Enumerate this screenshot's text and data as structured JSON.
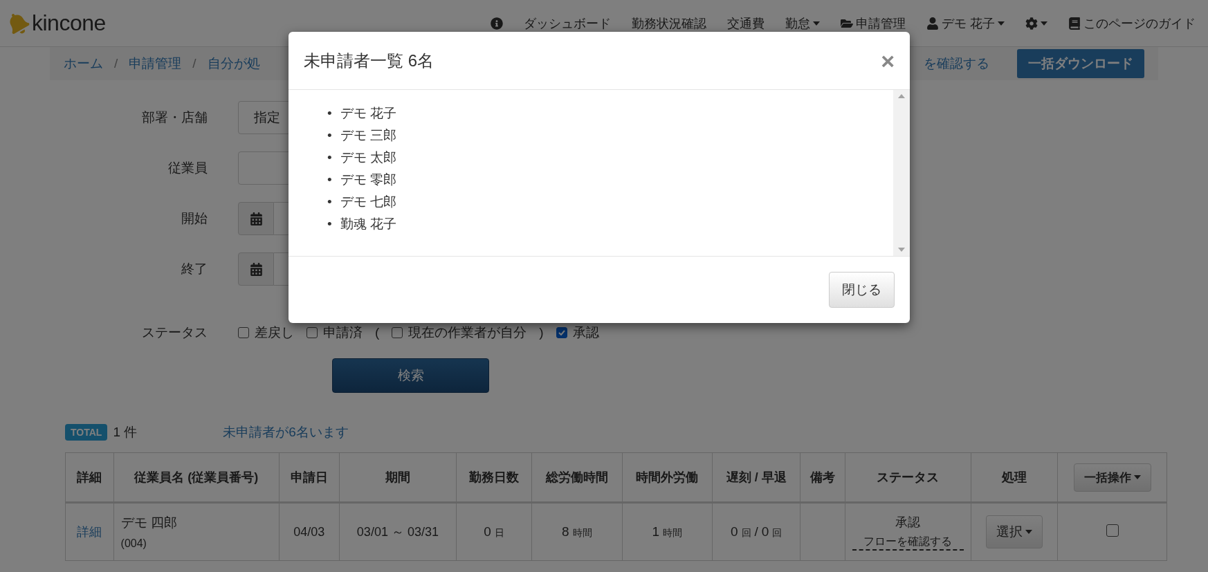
{
  "navbar": {
    "logo": "kincone",
    "items": [
      {
        "kind": "info"
      },
      {
        "kind": "text",
        "label": "ダッシュボード"
      },
      {
        "kind": "text",
        "label": "勤務状況確認"
      },
      {
        "kind": "text",
        "label": "交通費"
      },
      {
        "kind": "menu",
        "label": "勤怠"
      },
      {
        "kind": "folder",
        "label": "申請管理"
      },
      {
        "kind": "user",
        "label": "デモ 花子"
      },
      {
        "kind": "settings"
      },
      {
        "kind": "guide",
        "label": "このページのガイド"
      }
    ]
  },
  "breadcrumb": {
    "separator": "/",
    "items": [
      "ホーム",
      "申請管理",
      "自分が処"
    ],
    "link": "を確認する",
    "button": "一括ダウンロード"
  },
  "form": {
    "rows": [
      {
        "kind": "select",
        "label": "部署・店舗",
        "value": "指定"
      },
      {
        "kind": "input",
        "label": "従業員"
      },
      {
        "kind": "date",
        "label": "開始"
      },
      {
        "kind": "date",
        "label": "終了"
      }
    ],
    "status": {
      "label": "ステータス",
      "options": [
        {
          "kind": "plain",
          "label": "差戻し",
          "checked": false
        },
        {
          "kind": "plain",
          "label": "申請済",
          "checked": false
        },
        {
          "kind": "sub",
          "prefix": "(",
          "label": "現在の作業者が自分",
          "suffix": ")",
          "checked": false
        },
        {
          "kind": "plain",
          "label": "承認",
          "checked": true
        }
      ]
    },
    "search_button": "検索"
  },
  "summary": {
    "badge": "TOTAL",
    "count": "1 件",
    "link": "未申請者が6名います"
  },
  "table": {
    "columns": [
      "詳細",
      "従業員名 (従業員番号)",
      "申請日",
      "期間",
      "勤務日数",
      "総労働時間",
      "時間外労働",
      "遅刻 / 早退",
      "備考",
      "ステータス",
      "処理"
    ],
    "bulk_button": "一括操作",
    "rows": [
      {
        "detail": "詳細",
        "name": "デモ 四郎",
        "number": "(004)",
        "date": "04/03",
        "period": "03/01 ～ 03/31",
        "days": "0",
        "days_unit": "日",
        "total": "8",
        "total_unit": "時間",
        "overtime": "1",
        "overtime_unit": "時間",
        "late": "0",
        "late_unit": "回",
        "separator": "/",
        "early": "0",
        "early_unit": "回",
        "status": "承認",
        "flow_link": "フローを確認する",
        "action": "選択",
        "checked": false
      }
    ]
  },
  "modal": {
    "title": "未申請者一覧 6名",
    "close": "×",
    "bullet": "•",
    "names": [
      "デモ 花子",
      "デモ 三郎",
      "デモ 太郎",
      "デモ 零郎",
      "デモ 七郎",
      "勤魂 花子"
    ],
    "footer_button": "閉じる"
  }
}
